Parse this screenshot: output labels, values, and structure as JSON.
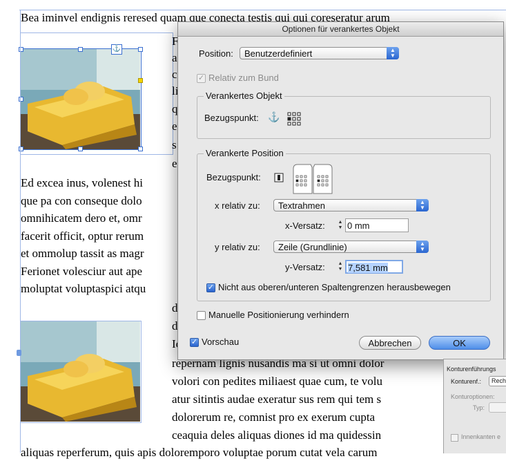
{
  "document": {
    "lines_top": [
      "Bea iminvel endignis reresed quam que conecta testis qui qui coreseratur arum"
    ],
    "lines_left": [
      "Ed excea inus, volenest hi",
      "que pa con conseque dolo",
      "omnihicatem dero et, omr",
      "facerit officit, optur rerum",
      "et ommolup tassit as magr",
      "Ferionet volesciur aut ape",
      "moluptat voluptaspici atqu"
    ],
    "lines_col_right_top": [
      "F",
      "a",
      "c",
      "li",
      "q",
      "e",
      "s",
      "e"
    ],
    "lines_mid_frag": [
      "d",
      "d",
      "Ic"
    ],
    "lines_bottom": [
      "repernam lignis nusandis ma si ut omni dolor",
      "volori con pedites miliaest quae cum, te volu",
      "atur sitintis audae exeratur sus rem qui tem s",
      "dolorerum re, comnist pro ex exerum cupta",
      "ceaquia deles aliquas diones id ma quidessin"
    ],
    "line_last": "aliquas reperferum, quis apis doloremporo voluptae porum cutat vela carum"
  },
  "dialog": {
    "title": "Optionen für verankertes Objekt",
    "position_label": "Position:",
    "position_value": "Benutzerdefiniert",
    "relativ_bund_label": "Relativ zum Bund",
    "anchored_object_group": "Verankertes Objekt",
    "bezugspunkt_label": "Bezugspunkt:",
    "anchored_position_group": "Verankerte Position",
    "bezugspunkt2_label": "Bezugspunkt:",
    "x_relative_label": "x relativ zu:",
    "x_relative_value": "Textrahmen",
    "x_offset_label": "x-Versatz:",
    "x_offset_value": "0 mm",
    "y_relative_label": "y relativ zu:",
    "y_relative_value": "Zeile (Grundlinie)",
    "y_offset_label": "y-Versatz:",
    "y_offset_value": "7,581 mm",
    "keep_within_label": "Nicht aus oberen/unteren Spaltengrenzen herausbewegen",
    "prevent_manual_label": "Manuelle Positionierung verhindern",
    "preview_label": "Vorschau",
    "cancel_label": "Abbrechen",
    "ok_label": "OK"
  },
  "panel": {
    "title": "Konturenführungs",
    "contour_label": "Konturenf.:",
    "contour_value": "Rech",
    "options_label": "Konturoptionen:",
    "type_label": "Typ:",
    "inner_label": "Innenkanten e"
  },
  "colors": {
    "accent": "#2a66d0",
    "selection": "#b5d3ff",
    "frame_guide": "#9fb7e6"
  }
}
